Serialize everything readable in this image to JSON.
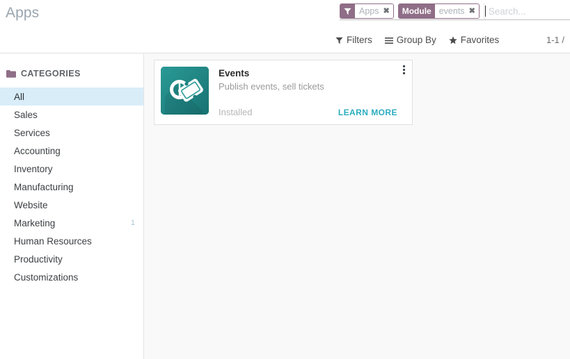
{
  "page": {
    "title": "Apps"
  },
  "search": {
    "placeholder": "Search...",
    "value": "",
    "facets": [
      {
        "icon": "filter-icon",
        "head_label": "",
        "values": "Apps",
        "close": "✖"
      },
      {
        "icon": "",
        "head_label": "Module",
        "values": "events",
        "close": "✖"
      }
    ]
  },
  "control_panel": {
    "menus": [
      {
        "label": "Filters",
        "icon": "filter-icon"
      },
      {
        "label": "Group By",
        "icon": "list-icon"
      },
      {
        "label": "Favorites",
        "icon": "star-icon"
      }
    ],
    "pager": "1-1 /"
  },
  "sidebar": {
    "header": "CATEGORIES",
    "header_icon": "folder-icon",
    "items": [
      {
        "label": "All",
        "badge": "",
        "active": true
      },
      {
        "label": "Sales",
        "badge": "",
        "active": false
      },
      {
        "label": "Services",
        "badge": "",
        "active": false
      },
      {
        "label": "Accounting",
        "badge": "",
        "active": false
      },
      {
        "label": "Inventory",
        "badge": "",
        "active": false
      },
      {
        "label": "Manufacturing",
        "badge": "",
        "active": false
      },
      {
        "label": "Website",
        "badge": "",
        "active": false
      },
      {
        "label": "Marketing",
        "badge": "1",
        "active": false
      },
      {
        "label": "Human Resources",
        "badge": "",
        "active": false
      },
      {
        "label": "Productivity",
        "badge": "",
        "active": false
      },
      {
        "label": "Customizations",
        "badge": "",
        "active": false
      }
    ]
  },
  "apps": [
    {
      "name": "Events",
      "summary": "Publish events, sell tickets",
      "state": "Installed",
      "action": "LEARN MORE",
      "icon": "events-ticket-icon",
      "icon_color": "#1e8080"
    }
  ],
  "colors": {
    "facet_purple": "#8f6e87",
    "sidebar_active": "#d9edf9",
    "link_teal": "#2bacbf",
    "content_bg": "#f9f9f9",
    "title_gray": "#9aa5ae"
  }
}
